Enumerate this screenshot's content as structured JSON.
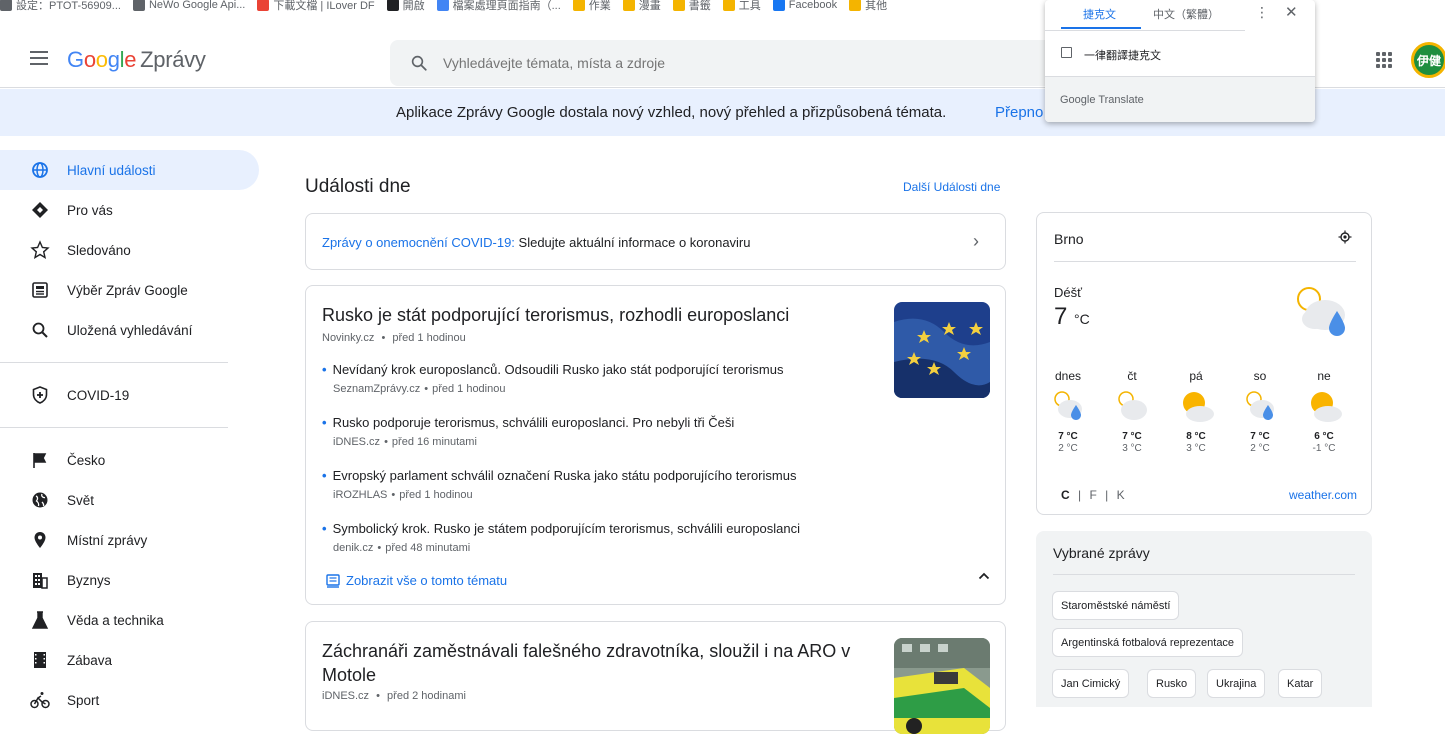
{
  "bookmarks": [
    {
      "label": "設定：PTOT-56909...",
      "color": "#5f6368"
    },
    {
      "label": "NeWo Google Api...",
      "color": "#5f6368"
    },
    {
      "label": "下載文檔 | ILover DF",
      "color": "#ea4335"
    },
    {
      "label": "開啟",
      "color": "#202124"
    },
    {
      "label": "檔案處理頁面指南（...",
      "color": "#4285f4"
    },
    {
      "label": "作業",
      "color": "#f4b400"
    },
    {
      "label": "漫畫",
      "color": "#f4b400"
    },
    {
      "label": "書籤",
      "color": "#f4b400"
    },
    {
      "label": "工具",
      "color": "#f4b400"
    },
    {
      "label": "Facebook",
      "color": "#1877f2"
    },
    {
      "label": "其他",
      "color": "#f4b400"
    }
  ],
  "header": {
    "logo_g": "G",
    "logo_o1": "o",
    "logo_o2": "o",
    "logo_g2": "g",
    "logo_l": "l",
    "logo_e": "e",
    "logo_rest": "Zprávy",
    "search_placeholder": "Vyhledávejte témata, místa a zdroje",
    "avatar_text": "伊健"
  },
  "banner": {
    "text": "Aplikace Zprávy Google dostala nový vzhled, nový přehled a přizpůsobená témata.",
    "link": "Přepno"
  },
  "translate": {
    "tab_active": "捷克文",
    "tab_other": "中文（繁體）",
    "more": "⋮",
    "close": "✕",
    "checkbox_label": "一律翻譯捷克文",
    "footer": "Google Translate"
  },
  "sidebar": {
    "items": [
      {
        "label": "Hlavní události",
        "icon": "globe-icon"
      },
      {
        "label": "Pro vás",
        "icon": "diamond-icon"
      },
      {
        "label": "Sledováno",
        "icon": "star-icon"
      },
      {
        "label": "Výběr Zpráv Google",
        "icon": "newspaper-icon"
      },
      {
        "label": "Uložená vyhledávání",
        "icon": "search-icon"
      }
    ],
    "covid": {
      "label": "COVID-19",
      "icon": "shield-icon"
    },
    "sections": [
      {
        "label": "Česko",
        "icon": "flag-icon"
      },
      {
        "label": "Svět",
        "icon": "world-icon"
      },
      {
        "label": "Místní zprávy",
        "icon": "pin-icon"
      },
      {
        "label": "Byznys",
        "icon": "building-icon"
      },
      {
        "label": "Věda a technika",
        "icon": "flask-icon"
      },
      {
        "label": "Zábava",
        "icon": "film-icon"
      },
      {
        "label": "Sport",
        "icon": "bike-icon"
      }
    ]
  },
  "main": {
    "title": "Události dne",
    "more_link": "Další Události dne",
    "covid_link": "Zprávy o onemocnění COVID-19:",
    "covid_text": " Sledujte aktuální informace o koronaviru",
    "story1": {
      "title": "Rusko je stát podporující terorismus, rozhodli europoslanci",
      "source": "Novinky.cz",
      "time": "před 1 hodinou",
      "subs": [
        {
          "title": "Nevídaný krok europoslanců. Odsoudili Rusko jako stát podporující terorismus",
          "source": "SeznamZprávy.cz",
          "time": "před 1 hodinou"
        },
        {
          "title": "Rusko podporuje terorismus, schválili europoslanci. Pro nebyli tři Češi",
          "source": "iDNES.cz",
          "time": "před 16 minutami"
        },
        {
          "title": "Evropský parlament schválil označení Ruska jako státu podporujícího terorismus",
          "source": "iROZHLAS",
          "time": "před 1 hodinou"
        },
        {
          "title": "Symbolický krok. Rusko je státem podporujícím terorismus, schválili europoslanci",
          "source": "denik.cz",
          "time": "před 48 minutami"
        }
      ],
      "show_all": "Zobrazit vše o tomto tématu"
    },
    "story2": {
      "title": "Záchranáři zaměstnávali falešného zdravotníka, sloužil i na ARO v Motole",
      "source": "iDNES.cz",
      "time": "před 2 hodinami"
    },
    "dot": "•"
  },
  "weather": {
    "city": "Brno",
    "condition": "Déšť",
    "temp": "7",
    "unit": "°C",
    "days": [
      {
        "day": "dnes",
        "hi": "7 °C",
        "lo": "2 °C",
        "icon": "partly-cloudy-rain-icon"
      },
      {
        "day": "čt",
        "hi": "7 °C",
        "lo": "3 °C",
        "icon": "partly-cloudy-icon"
      },
      {
        "day": "pá",
        "hi": "8 °C",
        "lo": "3 °C",
        "icon": "sun-cloud-icon"
      },
      {
        "day": "so",
        "hi": "7 °C",
        "lo": "2 °C",
        "icon": "partly-cloudy-rain-icon"
      },
      {
        "day": "ne",
        "hi": "6 °C",
        "lo": "-1 °C",
        "icon": "sun-cloud-icon"
      }
    ],
    "units": {
      "c": "C",
      "f": "F",
      "k": "K",
      "sep": "|"
    },
    "source": "weather.com"
  },
  "topics": {
    "title": "Vybrané zprávy",
    "chips": [
      "Staroměstské náměstí",
      "Argentinská fotbalová reprezentace",
      "Jan Cimický",
      "Rusko",
      "Ukrajina",
      "Katar"
    ]
  },
  "colors": {
    "accent": "#1a73e8",
    "banner_bg": "#e8f0fe",
    "active_bg": "#e8f0fe"
  }
}
